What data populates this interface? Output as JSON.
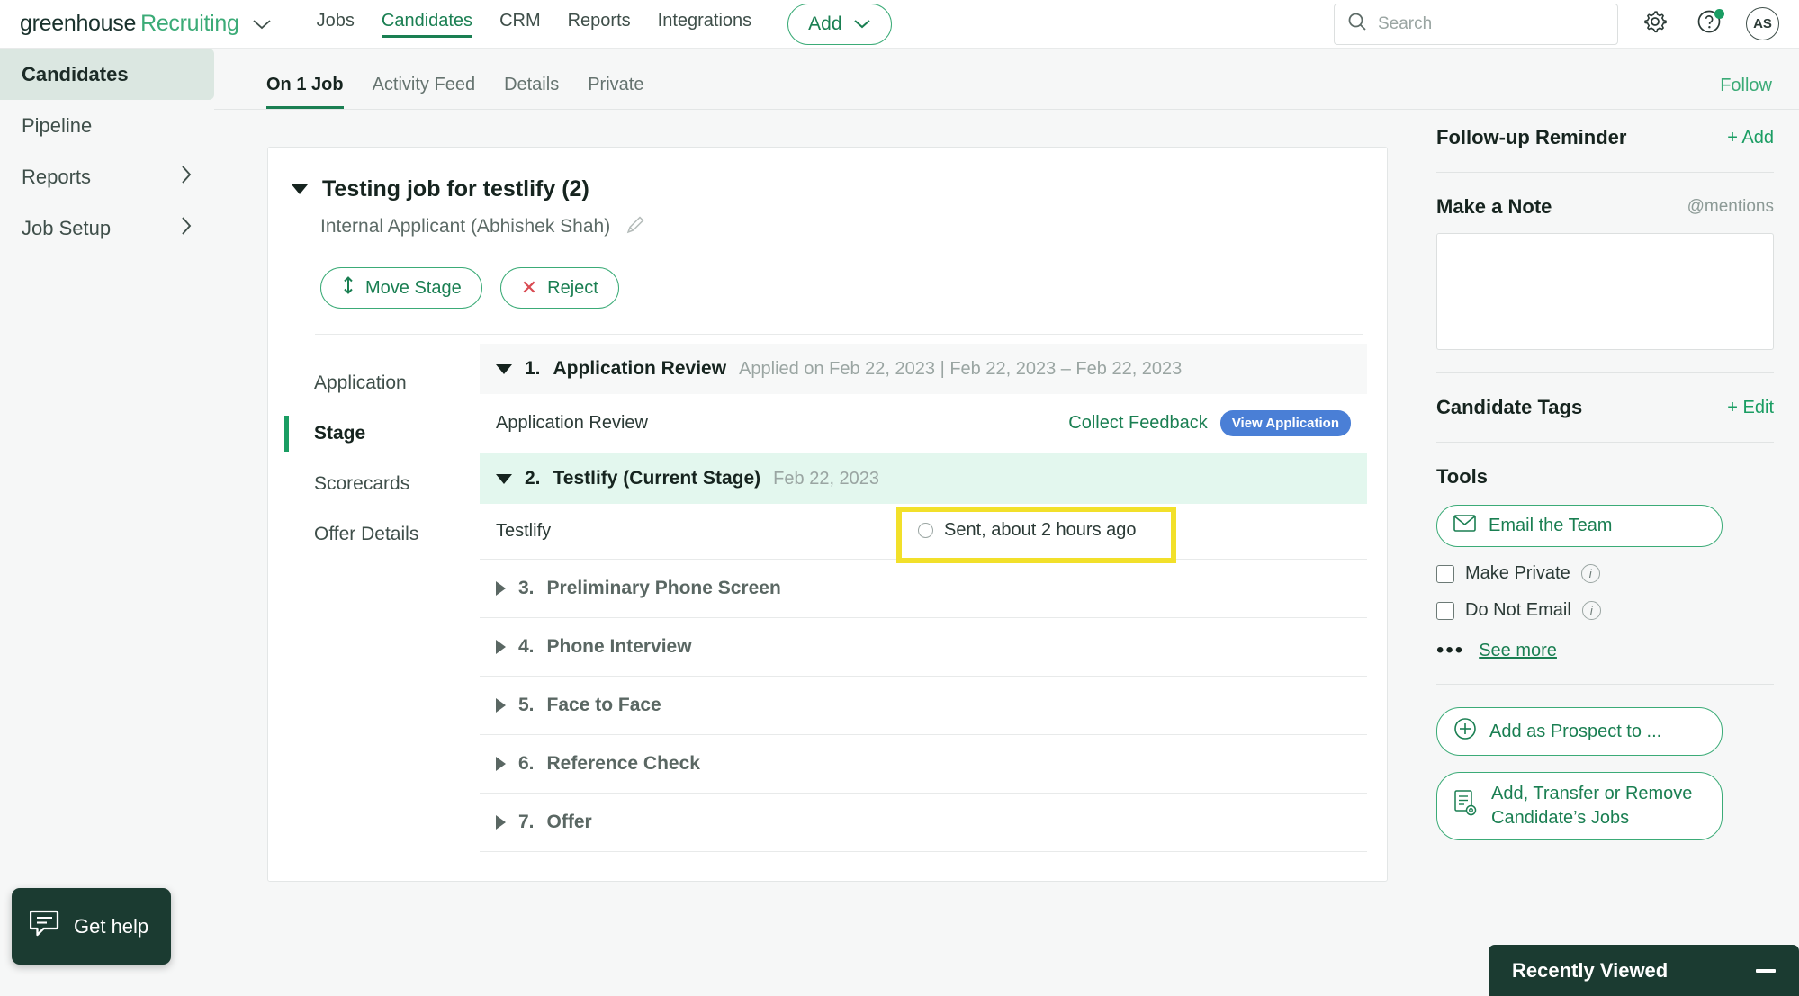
{
  "topnav": {
    "logo_primary": "greenhouse",
    "logo_secondary": "Recruiting",
    "links": [
      {
        "label": "Jobs",
        "active": false
      },
      {
        "label": "Candidates",
        "active": true
      },
      {
        "label": "CRM",
        "active": false
      },
      {
        "label": "Reports",
        "active": false
      },
      {
        "label": "Integrations",
        "active": false
      }
    ],
    "add_button": "Add",
    "search_placeholder": "Search",
    "search_value": "",
    "avatar_initials": "AS"
  },
  "sidebar": {
    "items": [
      {
        "label": "Candidates",
        "active": true,
        "chevron": false
      },
      {
        "label": "Pipeline",
        "active": false,
        "chevron": false
      },
      {
        "label": "Reports",
        "active": false,
        "chevron": true
      },
      {
        "label": "Job Setup",
        "active": false,
        "chevron": true
      }
    ]
  },
  "tabbar": {
    "tabs": [
      {
        "label": "On 1 Job",
        "active": true
      },
      {
        "label": "Activity Feed",
        "active": false
      },
      {
        "label": "Details",
        "active": false
      },
      {
        "label": "Private",
        "active": false
      }
    ],
    "follow": "Follow"
  },
  "job": {
    "title": "Testing job for testlify (2)",
    "source": "Internal Applicant (Abhishek Shah)",
    "move_stage": "Move Stage",
    "reject": "Reject"
  },
  "subnav": {
    "items": [
      {
        "label": "Application",
        "active": false
      },
      {
        "label": "Stage",
        "active": true
      },
      {
        "label": "Scorecards",
        "active": false
      },
      {
        "label": "Offer Details",
        "active": false
      }
    ]
  },
  "stages": {
    "application_review": {
      "number": "1.",
      "name": "Application Review",
      "meta": "Applied on Feb 22, 2023 | Feb 22, 2023 – Feb 22, 2023",
      "row_label": "Application Review",
      "collect_feedback": "Collect Feedback",
      "view_application": "View Application"
    },
    "testlify": {
      "number": "2.",
      "name": "Testlify (Current Stage)",
      "meta": "Feb 22, 2023",
      "row_label": "Testlify",
      "status": "Sent, about 2 hours ago"
    },
    "collapsed": [
      {
        "number": "3.",
        "name": "Preliminary Phone Screen"
      },
      {
        "number": "4.",
        "name": "Phone Interview"
      },
      {
        "number": "5.",
        "name": "Face to Face"
      },
      {
        "number": "6.",
        "name": "Reference Check"
      },
      {
        "number": "7.",
        "name": "Offer"
      }
    ]
  },
  "rightbar": {
    "followup_title": "Follow-up Reminder",
    "followup_add": "+ Add",
    "note_title": "Make a Note",
    "note_mentions": "@mentions",
    "note_value": "",
    "tags_title": "Candidate Tags",
    "tags_edit": "+ Edit",
    "tools_title": "Tools",
    "email_team": "Email the Team",
    "make_private": "Make Private",
    "do_not_email": "Do Not Email",
    "see_more": "See more",
    "add_prospect": "Add as Prospect to ...",
    "transfer_jobs": "Add, Transfer or Remove Candidate’s Jobs"
  },
  "floating": {
    "get_help": "Get help",
    "recently_viewed": "Recently Viewed"
  },
  "colors": {
    "brand_green": "#1a7f52",
    "accent_green": "#3bab77",
    "dark_green": "#1b3b31",
    "highlight_yellow": "#f2e02a",
    "badge_blue": "#4a7fd6",
    "reject_red": "#d94a52",
    "current_stage_bg": "#e3f7ee"
  }
}
